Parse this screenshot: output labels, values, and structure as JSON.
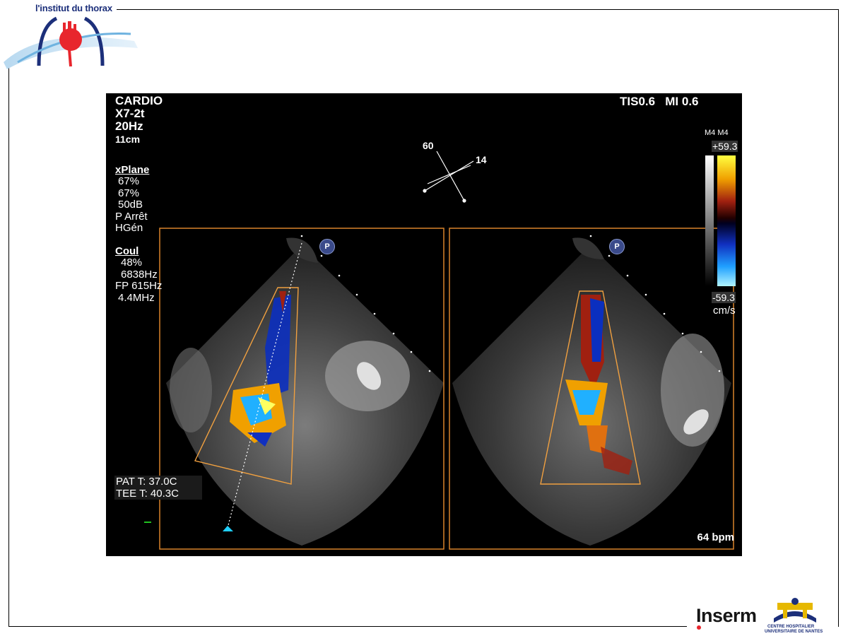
{
  "brand": {
    "title": "l'institut du thorax",
    "footer_logo_text": "Inserm",
    "footer_logo2_line1": "CENTRE HOSPITALIER",
    "footer_logo2_line2": "UNIVERSITAIRE DE NANTES"
  },
  "echo": {
    "mode": "CARDIO",
    "probe": "X7-2t",
    "frame_rate": "20Hz",
    "depth": "11cm",
    "tis": "TIS0.6",
    "mi": "MI 0.6",
    "xplane": {
      "title": "xPlane",
      "lines": [
        "67%",
        "67%",
        "50dB",
        "P Arrêt",
        "HGén"
      ]
    },
    "color": {
      "title": "Coul",
      "lines": [
        "48%",
        "6838Hz",
        "FP 615Hz",
        "4.4MHz"
      ]
    },
    "patient_temp": "PAT T: 37.0C",
    "tee_temp": "TEE T: 40.3C",
    "heart_rate": "64 bpm",
    "plane_angle_1": "60",
    "plane_angle_2": "14",
    "scale": {
      "map_label": "M4 M4",
      "max": "+59.3",
      "min": "-59.3",
      "unit": "cm/s"
    },
    "marker_label": "P"
  },
  "colors": {
    "accent_orange": "#d9822b",
    "title_blue": "#1c2f7a",
    "logo_red": "#e8262d"
  }
}
